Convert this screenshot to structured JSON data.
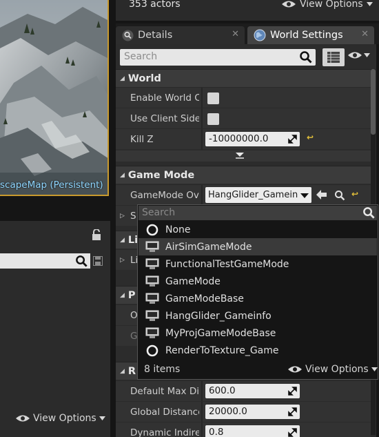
{
  "viewport": {
    "map_label": "scapeMap (Persistent)"
  },
  "outliner": {
    "actor_count": "353 actors",
    "view_options": "View Options"
  },
  "tabs": [
    {
      "label": "Details",
      "icon": "magnifier-icon"
    },
    {
      "label": "World Settings",
      "icon": "globe-icon"
    }
  ],
  "details": {
    "search_placeholder": "Search",
    "categories": {
      "world": "World",
      "game_mode": "Game Mode",
      "lighting_fragment": "Li",
      "physics_fragment": "P",
      "rendering_fragment": "R"
    },
    "world_rows": {
      "enable_world_composition": "Enable World Co",
      "use_client_side": "Use Client Side L",
      "kill_z": "Kill Z",
      "kill_z_value": "-10000000.0"
    },
    "game_mode_rows": {
      "override_label": "GameMode Over",
      "override_value": "HangGlider_Gameinfo",
      "selected_frag": "S",
      "lighting_sub_frag": "Li",
      "physics_o_frag": "O",
      "physics_g_frag": "G"
    },
    "rendering_rows": [
      {
        "label": "Default Max Dist",
        "value": "600.0"
      },
      {
        "label": "Global DistanceF",
        "value": "20000.0"
      },
      {
        "label": "Dynamic Indirect",
        "value": "0.8"
      }
    ]
  },
  "dropdown": {
    "search_placeholder": "Search",
    "items": [
      {
        "label": "None",
        "icon": "circle-icon"
      },
      {
        "label": "AirSimGameMode",
        "icon": "blueprint-class-icon"
      },
      {
        "label": "FunctionalTestGameMode",
        "icon": "blueprint-class-icon"
      },
      {
        "label": "GameMode",
        "icon": "blueprint-class-icon"
      },
      {
        "label": "GameModeBase",
        "icon": "blueprint-class-icon"
      },
      {
        "label": "HangGlider_Gameinfo",
        "icon": "blueprint-class-icon"
      },
      {
        "label": "MyProjGameModeBase",
        "icon": "blueprint-class-icon"
      },
      {
        "label": "RenderToTexture_Game",
        "icon": "circle-icon"
      }
    ],
    "highlighted_item": "AirSimGameMode",
    "count": "8 items",
    "view_options": "View Options"
  },
  "left_panel": {
    "view_options": "View Options"
  },
  "colors": {
    "accent_reset": "#e6c23a",
    "map_label": "#8fd6ff",
    "viewport_border": "#c99a2e"
  }
}
